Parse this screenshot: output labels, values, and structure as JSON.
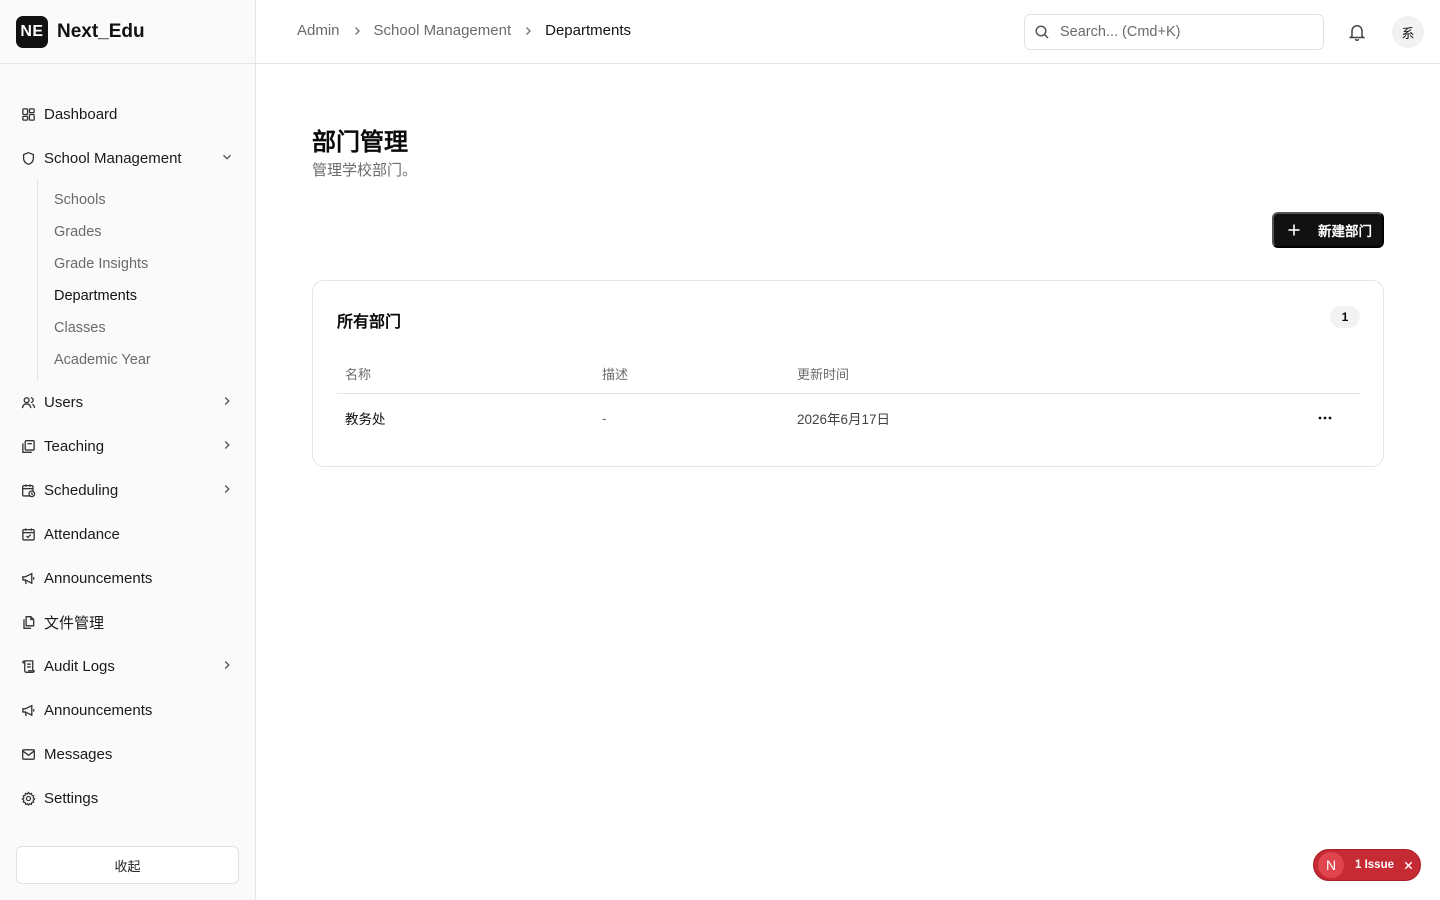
{
  "brand": {
    "logo": "NE",
    "name": "Next_Edu"
  },
  "sidebar": {
    "items": [
      {
        "label": "Dashboard",
        "icon": "dashboard-icon"
      },
      {
        "label": "School Management",
        "icon": "shield-icon",
        "expanded": true,
        "children": [
          "Schools",
          "Grades",
          "Grade Insights",
          "Departments",
          "Classes",
          "Academic Year"
        ],
        "active_child": "Departments"
      },
      {
        "label": "Users",
        "icon": "users-icon"
      },
      {
        "label": "Teaching",
        "icon": "book-icon"
      },
      {
        "label": "Scheduling",
        "icon": "calendar-clock-icon"
      },
      {
        "label": "Attendance",
        "icon": "calendar-check-icon"
      },
      {
        "label": "Announcements",
        "icon": "megaphone-icon"
      },
      {
        "label": "文件管理",
        "icon": "files-icon"
      },
      {
        "label": "Audit Logs",
        "icon": "scroll-icon"
      },
      {
        "label": "Announcements",
        "icon": "megaphone-icon"
      },
      {
        "label": "Messages",
        "icon": "mail-icon"
      },
      {
        "label": "Settings",
        "icon": "gear-icon"
      }
    ],
    "collapse_label": "收起"
  },
  "header": {
    "breadcrumb": [
      "Admin",
      "School Management",
      "Departments"
    ],
    "search_placeholder": "Search... (Cmd+K)",
    "avatar_text": "系"
  },
  "main": {
    "title": "部门管理",
    "subtitle": "管理学校部门。",
    "new_button_label": "新建部门",
    "card": {
      "title": "所有部门",
      "count": "1",
      "columns": [
        "名称",
        "描述",
        "更新时间"
      ],
      "rows": [
        {
          "name": "教务处",
          "description": "-",
          "updated": "2026年6月17日"
        }
      ]
    }
  },
  "issue_badge": {
    "letter": "N",
    "label": "1 Issue"
  },
  "colors": {
    "primary": "#111111",
    "muted_text": "#6b6b6b",
    "border": "#e5e5e5",
    "issue_red": "#c62a32"
  }
}
